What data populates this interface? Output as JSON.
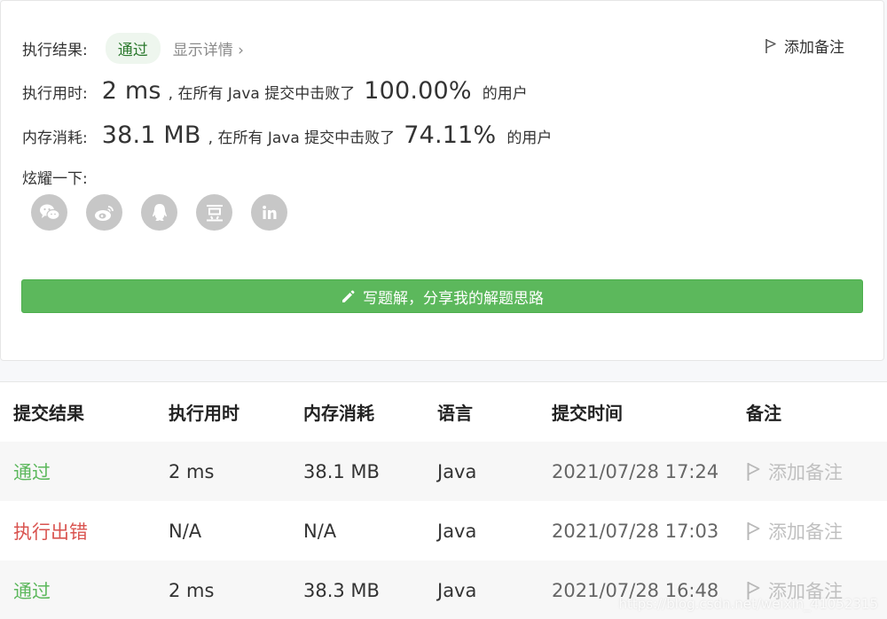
{
  "result": {
    "label": "执行结果:",
    "status": "通过",
    "detail_link": "显示详情 ›",
    "add_note": "添加备注"
  },
  "runtime": {
    "label": "执行用时:",
    "value": "2 ms",
    "mid_text": ", 在所有 Java 提交中击败了",
    "percent": "100.00%",
    "suffix": "的用户"
  },
  "memory": {
    "label": "内存消耗:",
    "value": "38.1 MB",
    "mid_text": ", 在所有 Java 提交中击败了",
    "percent": "74.11%",
    "suffix": "的用户"
  },
  "share": {
    "label": "炫耀一下:",
    "icons": [
      "wechat-icon",
      "weibo-icon",
      "qq-icon",
      "douban-icon",
      "linkedin-icon"
    ]
  },
  "write_solution_label": "写题解，分享我的解题思路",
  "table": {
    "headers": [
      "提交结果",
      "执行用时",
      "内存消耗",
      "语言",
      "提交时间",
      "备注"
    ],
    "rows": [
      {
        "status": "通过",
        "runtime": "2 ms",
        "memory": "38.1 MB",
        "lang": "Java",
        "time": "2021/07/28 17:24",
        "note": "添加备注"
      },
      {
        "status": "执行出错",
        "runtime": "N/A",
        "memory": "N/A",
        "lang": "Java",
        "time": "2021/07/28 17:03",
        "note": "添加备注"
      },
      {
        "status": "通过",
        "runtime": "2 ms",
        "memory": "38.3 MB",
        "lang": "Java",
        "time": "2021/07/28 16:48",
        "note": "添加备注"
      }
    ]
  },
  "watermark": "https://blog.csdn.net/weixin_41052315",
  "colors": {
    "accent_green": "#5cb85c",
    "error_red": "#d9534f",
    "icon_gray": "#c7c7c7"
  }
}
